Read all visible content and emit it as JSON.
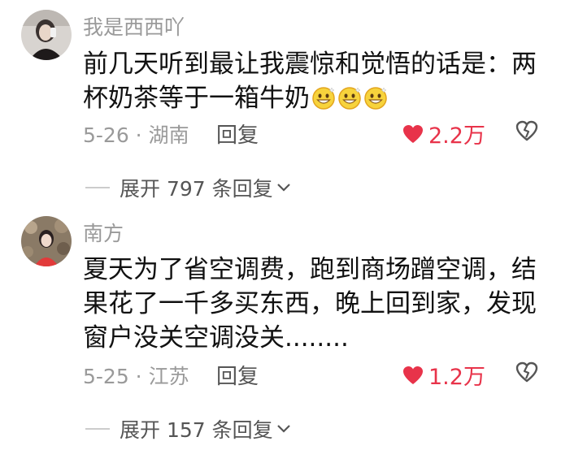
{
  "comments": [
    {
      "username": "我是西西吖",
      "text": "前几天听到最让我震惊和觉悟的话是：两杯奶茶等于一箱牛奶",
      "emojis": [
        "grinning-face-icon",
        "grinning-face-icon",
        "grinning-face-icon"
      ],
      "date_location": "5-26 · 湖南",
      "reply_label": "回复",
      "likes": "2.2万",
      "expand_label": "展开 797 条回复"
    },
    {
      "username": "南方",
      "text": "夏天为了省空调费，跑到商场蹭空调，结果花了一千多买东西，晚上回到家，发现窗户没关空调没关........",
      "date_location": "5-25 · 江苏",
      "reply_label": "回复",
      "likes": "1.2万",
      "expand_label": "展开 157 条回复"
    }
  ],
  "colors": {
    "like_red": "#e8334a",
    "meta_gray": "#9a9a9a"
  }
}
